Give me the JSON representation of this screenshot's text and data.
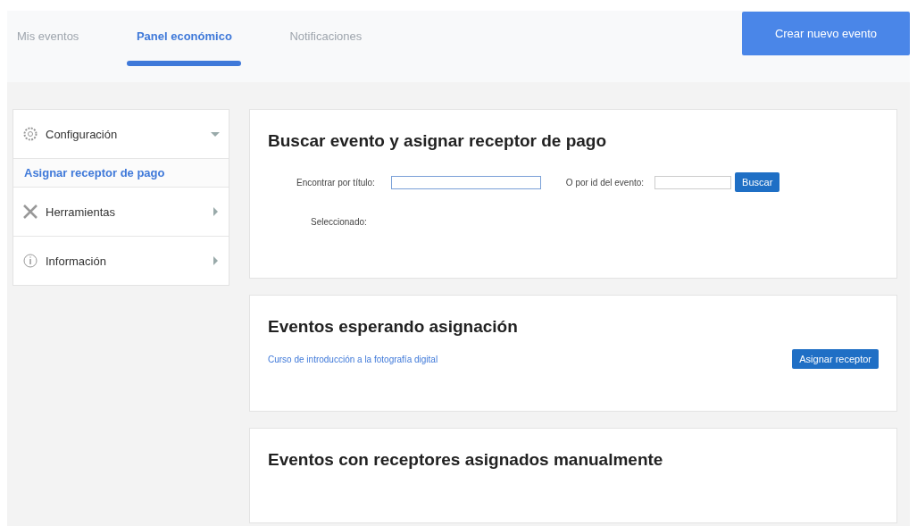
{
  "tabs": [
    {
      "label": "Mis eventos",
      "selected": false
    },
    {
      "label": "Panel económico",
      "selected": true
    },
    {
      "label": "Notificaciones",
      "selected": false
    }
  ],
  "create_button": "Crear nuevo evento",
  "sidebar": {
    "items": [
      {
        "label": "Configuración",
        "expanded": true,
        "children": [
          {
            "label": "Asignar receptor de pago",
            "selected": true
          }
        ]
      },
      {
        "label": "Herramientas",
        "expanded": false
      },
      {
        "label": "Información",
        "expanded": false
      }
    ]
  },
  "search_card": {
    "title": "Buscar evento y asignar receptor de pago",
    "title_label": "Encontrar por título:",
    "id_label": "O por id del evento:",
    "search_button": "Buscar",
    "selected_label": "Seleccionado:"
  },
  "waiting_card": {
    "title": "Eventos esperando asignación",
    "events": [
      {
        "name": "Curso de introducción a la fotografía digital",
        "action": "Asignar receptor"
      }
    ]
  },
  "manual_card": {
    "title": "Eventos con receptores asignados manualmente"
  }
}
